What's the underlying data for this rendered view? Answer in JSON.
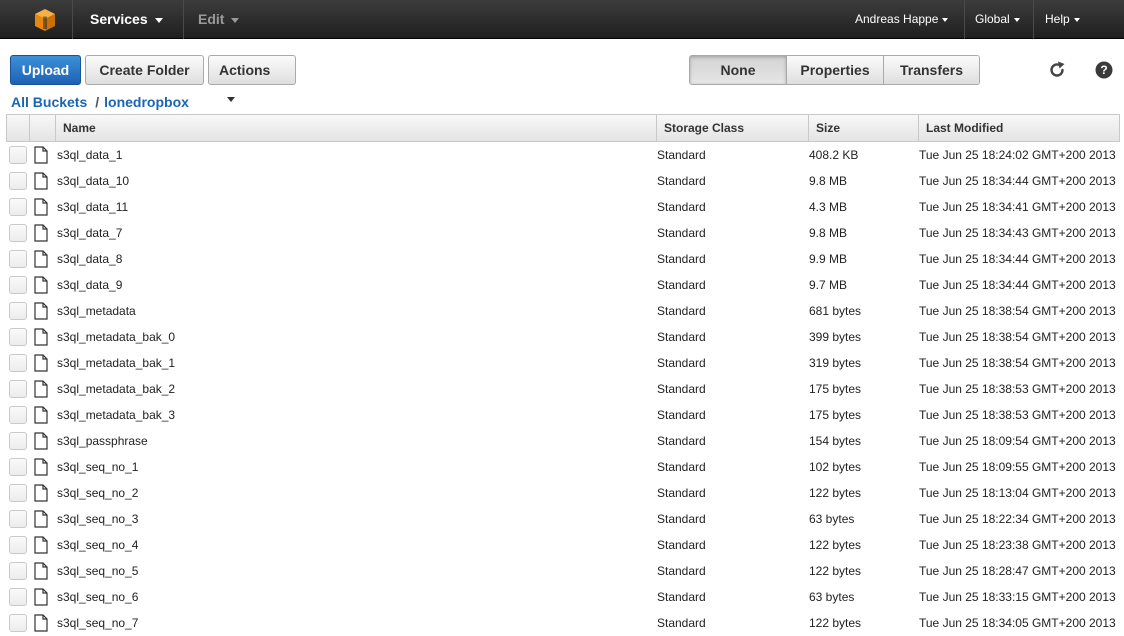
{
  "topbar": {
    "services_label": "Services",
    "edit_label": "Edit",
    "user_label": "Andreas Happe",
    "region_label": "Global",
    "help_label": "Help"
  },
  "toolbar": {
    "upload_label": "Upload",
    "create_folder_label": "Create Folder",
    "actions_label": "Actions",
    "view_none_label": "None",
    "view_properties_label": "Properties",
    "view_transfers_label": "Transfers",
    "active_view": "None"
  },
  "breadcrumb": {
    "root_label": "All Buckets",
    "separator": "/",
    "bucket_label": "lonedropbox"
  },
  "table": {
    "columns": {
      "name": "Name",
      "storage_class": "Storage Class",
      "size": "Size",
      "last_modified": "Last Modified"
    },
    "rows": [
      {
        "name": "s3ql_data_1",
        "storage_class": "Standard",
        "size": "408.2 KB",
        "last_modified": "Tue Jun 25 18:24:02 GMT+200 2013"
      },
      {
        "name": "s3ql_data_10",
        "storage_class": "Standard",
        "size": "9.8 MB",
        "last_modified": "Tue Jun 25 18:34:44 GMT+200 2013"
      },
      {
        "name": "s3ql_data_11",
        "storage_class": "Standard",
        "size": "4.3 MB",
        "last_modified": "Tue Jun 25 18:34:41 GMT+200 2013"
      },
      {
        "name": "s3ql_data_7",
        "storage_class": "Standard",
        "size": "9.8 MB",
        "last_modified": "Tue Jun 25 18:34:43 GMT+200 2013"
      },
      {
        "name": "s3ql_data_8",
        "storage_class": "Standard",
        "size": "9.9 MB",
        "last_modified": "Tue Jun 25 18:34:44 GMT+200 2013"
      },
      {
        "name": "s3ql_data_9",
        "storage_class": "Standard",
        "size": "9.7 MB",
        "last_modified": "Tue Jun 25 18:34:44 GMT+200 2013"
      },
      {
        "name": "s3ql_metadata",
        "storage_class": "Standard",
        "size": "681 bytes",
        "last_modified": "Tue Jun 25 18:38:54 GMT+200 2013"
      },
      {
        "name": "s3ql_metadata_bak_0",
        "storage_class": "Standard",
        "size": "399 bytes",
        "last_modified": "Tue Jun 25 18:38:54 GMT+200 2013"
      },
      {
        "name": "s3ql_metadata_bak_1",
        "storage_class": "Standard",
        "size": "319 bytes",
        "last_modified": "Tue Jun 25 18:38:54 GMT+200 2013"
      },
      {
        "name": "s3ql_metadata_bak_2",
        "storage_class": "Standard",
        "size": "175 bytes",
        "last_modified": "Tue Jun 25 18:38:53 GMT+200 2013"
      },
      {
        "name": "s3ql_metadata_bak_3",
        "storage_class": "Standard",
        "size": "175 bytes",
        "last_modified": "Tue Jun 25 18:38:53 GMT+200 2013"
      },
      {
        "name": "s3ql_passphrase",
        "storage_class": "Standard",
        "size": "154 bytes",
        "last_modified": "Tue Jun 25 18:09:54 GMT+200 2013"
      },
      {
        "name": "s3ql_seq_no_1",
        "storage_class": "Standard",
        "size": "102 bytes",
        "last_modified": "Tue Jun 25 18:09:55 GMT+200 2013"
      },
      {
        "name": "s3ql_seq_no_2",
        "storage_class": "Standard",
        "size": "122 bytes",
        "last_modified": "Tue Jun 25 18:13:04 GMT+200 2013"
      },
      {
        "name": "s3ql_seq_no_3",
        "storage_class": "Standard",
        "size": "63 bytes",
        "last_modified": "Tue Jun 25 18:22:34 GMT+200 2013"
      },
      {
        "name": "s3ql_seq_no_4",
        "storage_class": "Standard",
        "size": "122 bytes",
        "last_modified": "Tue Jun 25 18:23:38 GMT+200 2013"
      },
      {
        "name": "s3ql_seq_no_5",
        "storage_class": "Standard",
        "size": "122 bytes",
        "last_modified": "Tue Jun 25 18:28:47 GMT+200 2013"
      },
      {
        "name": "s3ql_seq_no_6",
        "storage_class": "Standard",
        "size": "63 bytes",
        "last_modified": "Tue Jun 25 18:33:15 GMT+200 2013"
      },
      {
        "name": "s3ql_seq_no_7",
        "storage_class": "Standard",
        "size": "122 bytes",
        "last_modified": "Tue Jun 25 18:34:05 GMT+200 2013"
      }
    ]
  },
  "icons": {
    "logo": "aws-cube-icon",
    "refresh": "refresh-icon",
    "help": "help-icon",
    "file": "file-icon"
  },
  "colors": {
    "topbar": "#2b2b2b",
    "primary_button": "#1d62b4",
    "link": "#1a66b2",
    "logo": "#f39c12"
  }
}
